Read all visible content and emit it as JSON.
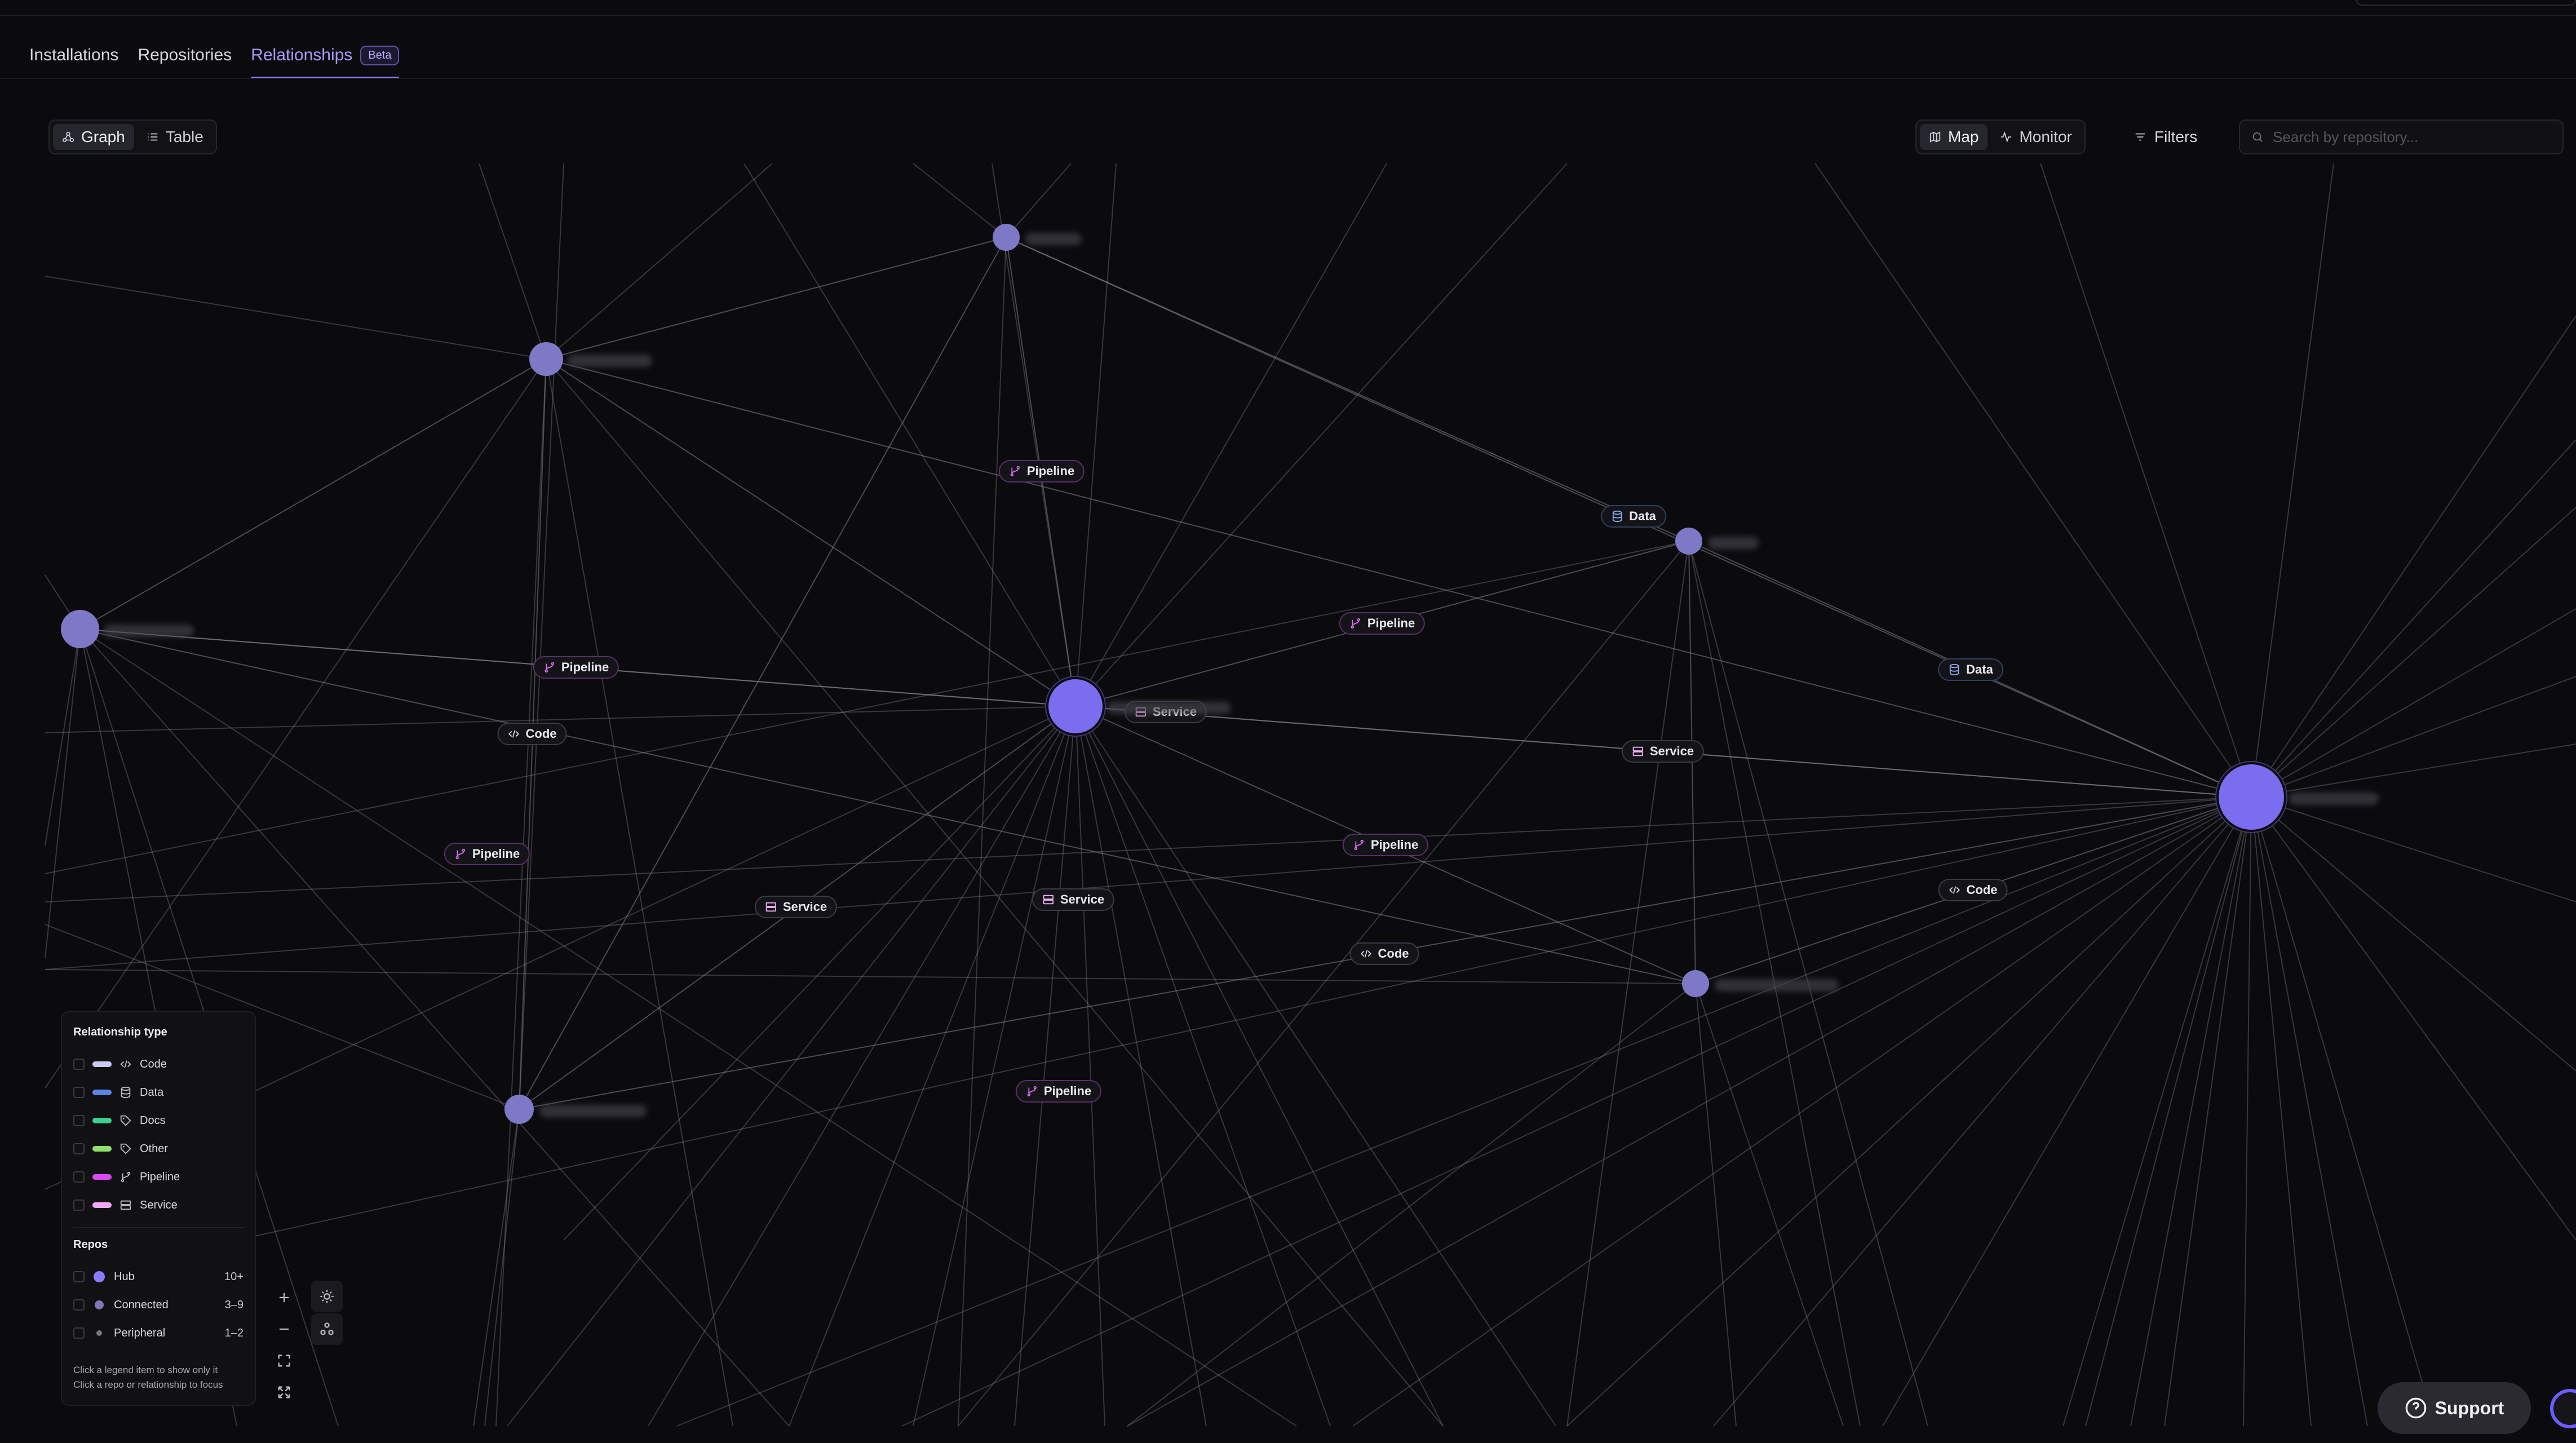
{
  "tabs": [
    {
      "label": "Installations"
    },
    {
      "label": "Repositories"
    },
    {
      "label": "Relationships",
      "badge": "Beta"
    }
  ],
  "view_toggle": {
    "graph_label": "Graph",
    "table_label": "Table",
    "selected": "Graph"
  },
  "mode_toggle": {
    "map_label": "Map",
    "monitor_label": "Monitor",
    "selected": "Map"
  },
  "filters_label": "Filters",
  "search": {
    "placeholder": "Search by repository...",
    "value": ""
  },
  "edge_labels": [
    {
      "type": "pipeline",
      "text": "Pipeline"
    },
    {
      "type": "data",
      "text": "Data"
    },
    {
      "type": "pipeline",
      "text": "Pipeline"
    },
    {
      "type": "data",
      "text": "Data"
    },
    {
      "type": "pipeline",
      "text": "Pipeline"
    },
    {
      "type": "code",
      "text": "Code"
    },
    {
      "type": "service",
      "text": "Service"
    },
    {
      "type": "service",
      "text": "Service"
    },
    {
      "type": "pipeline",
      "text": "Pipeline"
    },
    {
      "type": "pipeline",
      "text": "Pipeline"
    },
    {
      "type": "service",
      "text": "Service"
    },
    {
      "type": "service",
      "text": "Service"
    },
    {
      "type": "code",
      "text": "Code"
    },
    {
      "type": "code",
      "text": "Code"
    },
    {
      "type": "pipeline",
      "text": "Pipeline"
    }
  ],
  "legend": {
    "relationship_title": "Relationship type",
    "relationship_types": [
      {
        "label": "Code",
        "color": "#c9c9f5",
        "icon": "code-icon"
      },
      {
        "label": "Data",
        "color": "#5b84e6",
        "icon": "database-icon"
      },
      {
        "label": "Docs",
        "color": "#3fcf8e",
        "icon": "tag-icon"
      },
      {
        "label": "Other",
        "color": "#8fe06a",
        "icon": "tag-icon"
      },
      {
        "label": "Pipeline",
        "color": "#d94bf0",
        "icon": "branch-icon"
      },
      {
        "label": "Service",
        "color": "#f0a8f5",
        "icon": "server-icon"
      }
    ],
    "repos_title": "Repos",
    "repos": [
      {
        "label": "Hub",
        "count": "10+",
        "color": "#8a7cff"
      },
      {
        "label": "Connected",
        "count": "3–9",
        "color": "#7d77b8"
      },
      {
        "label": "Peripheral",
        "count": "1–2",
        "color": "#77777f"
      }
    ],
    "note_line1": "Click a legend item to show only it",
    "note_line2": "Click a repo or relationship to focus"
  },
  "support_label": "Support",
  "colors": {
    "accent": "#8d7bff",
    "hub": "#7b6cf0",
    "connected": "#7f78c6",
    "edge": "#8a8a92"
  }
}
